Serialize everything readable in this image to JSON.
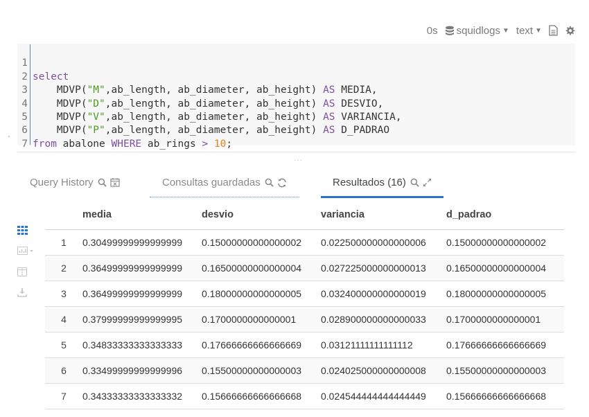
{
  "toolbar": {
    "exec_time": "0s",
    "database": "squidlogs",
    "format": "text"
  },
  "editor": {
    "lines": [
      {
        "num": "1"
      },
      {
        "num": "2"
      },
      {
        "num": "3"
      },
      {
        "num": "4"
      },
      {
        "num": "5"
      },
      {
        "num": "6"
      },
      {
        "num": "7"
      }
    ],
    "tokens": {
      "select": "select",
      "fn": "MDVP(",
      "args": ",ab_length, ab_diameter, ab_height) ",
      "as": "AS",
      "m": "\"M\"",
      "d": "\"D\"",
      "v": "\"V\"",
      "p": "\"P\"",
      "alias_media": " MEDIA,",
      "alias_desvio": " DESVIO,",
      "alias_var": " VARIANCIA,",
      "alias_dp": " D_PADRAO",
      "from": "from",
      "table": " abalone ",
      "where": "WHERE",
      "cond": " ab_rings ",
      "gt": ">",
      "ten": "10",
      "semi": ";"
    }
  },
  "tabs": {
    "history": "Query History",
    "saved": "Consultas guardadas",
    "results": "Resultados (16)"
  },
  "table": {
    "columns": [
      "media",
      "desvio",
      "variancia",
      "d_padrao"
    ],
    "rows": [
      {
        "idx": "1",
        "media": "0.30499999999999999",
        "desvio": "0.15000000000000002",
        "variancia": "0.022500000000000006",
        "d_padrao": "0.15000000000000002"
      },
      {
        "idx": "2",
        "media": "0.36499999999999999",
        "desvio": "0.16500000000000004",
        "variancia": "0.027225000000000013",
        "d_padrao": "0.16500000000000004"
      },
      {
        "idx": "3",
        "media": "0.36499999999999999",
        "desvio": "0.18000000000000005",
        "variancia": "0.032400000000000019",
        "d_padrao": "0.18000000000000005"
      },
      {
        "idx": "4",
        "media": "0.37999999999999995",
        "desvio": "0.1700000000000001",
        "variancia": "0.028900000000000033",
        "d_padrao": "0.1700000000000001"
      },
      {
        "idx": "5",
        "media": "0.34833333333333333",
        "desvio": "0.17666666666666669",
        "variancia": "0.03121111111111112",
        "d_padrao": "0.17666666666666669"
      },
      {
        "idx": "6",
        "media": "0.33499999999999996",
        "desvio": "0.15500000000000003",
        "variancia": "0.024025000000000008",
        "d_padrao": "0.15500000000000003"
      },
      {
        "idx": "7",
        "media": "0.34333333333333332",
        "desvio": "0.15666666666666668",
        "variancia": "0.024544444444444449",
        "d_padrao": "0.15666666666666668"
      }
    ]
  }
}
